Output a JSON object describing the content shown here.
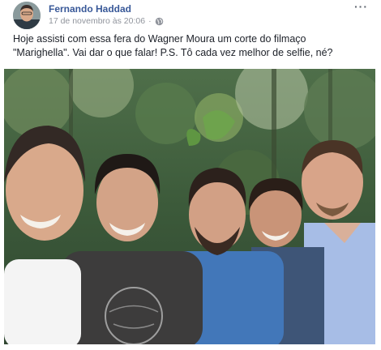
{
  "post": {
    "author": "Fernando Haddad",
    "timestamp": "17 de novembro às 20:06",
    "privacy_icon": "globe-icon",
    "more_icon": "more-options-icon",
    "more_label": "···",
    "text_line1": "Hoje assisti com essa fera do Wagner Moura um corte do filmaço",
    "text_line2": "\"Marighella\". Vai dar o que falar! P.S. Tô cada vez melhor de selfie, né?"
  },
  "colors": {
    "author_link": "#385898",
    "meta_gray": "#90949c",
    "text": "#1d2129"
  }
}
